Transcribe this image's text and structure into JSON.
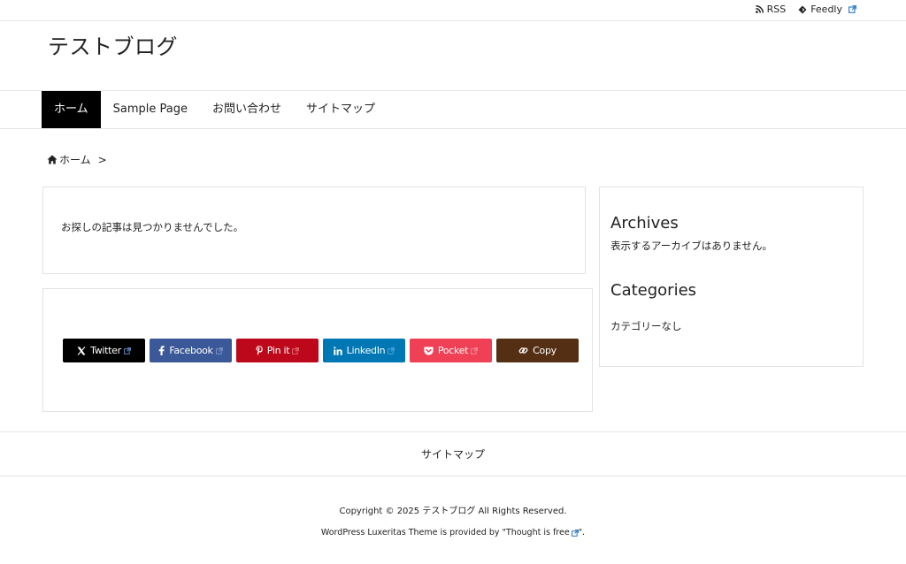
{
  "topbar": {
    "rss_label": "RSS",
    "feedly_label": "Feedly"
  },
  "site": {
    "title": "テストブログ"
  },
  "nav": {
    "items": [
      {
        "label": "ホーム",
        "active": true
      },
      {
        "label": "Sample Page",
        "active": false
      },
      {
        "label": "お問い合わせ",
        "active": false
      },
      {
        "label": "サイトマップ",
        "active": false
      }
    ]
  },
  "breadcrumb": {
    "home_label": "ホーム",
    "separator": ">"
  },
  "main": {
    "not_found_text": "お探しの記事は見つかりませんでした。"
  },
  "share": {
    "buttons": [
      {
        "label": "Twitter",
        "color": "#000000"
      },
      {
        "label": "Facebook",
        "color": "#3b5998"
      },
      {
        "label": "Pin it",
        "color": "#bd081c"
      },
      {
        "label": "LinkedIn",
        "color": "#0077b5"
      },
      {
        "label": "Pocket",
        "color": "#ef4056"
      },
      {
        "label": "Copy",
        "color": "#552f14"
      }
    ]
  },
  "sidebar": {
    "archives_title": "Archives",
    "archives_empty": "表示するアーカイブはありません。",
    "categories_title": "Categories",
    "categories_empty": "カテゴリーなし"
  },
  "footer": {
    "sitemap_label": "サイトマップ",
    "copyright": "Copyright © 2025 テストブログ All Rights Reserved.",
    "powered_prefix": "WordPress Luxeritas Theme is provided by \"Thought is free",
    "powered_suffix": "\"."
  }
}
